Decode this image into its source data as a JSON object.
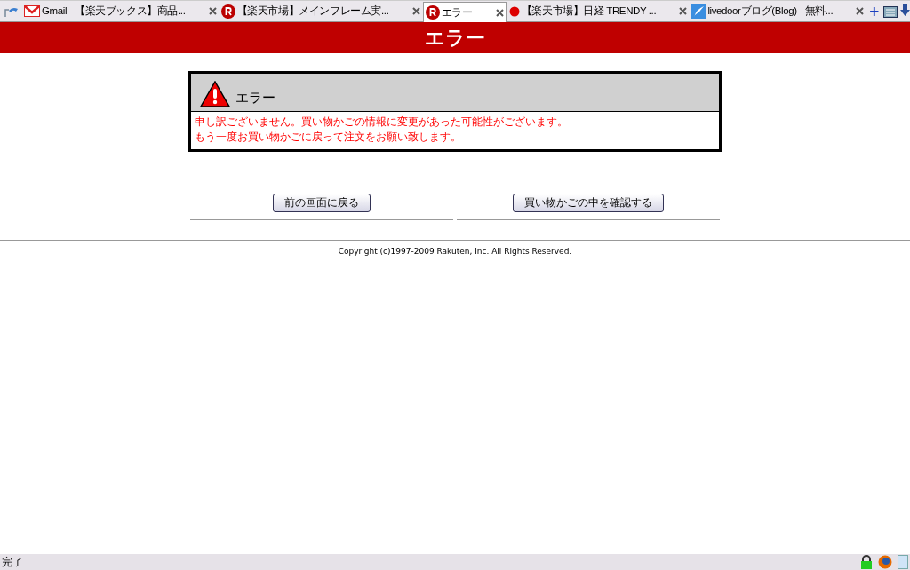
{
  "tabs": [
    {
      "label": "Gmail - 【楽天ブックス】商品...",
      "kind": "gmail",
      "selected": false
    },
    {
      "label": "【楽天市場】メインフレーム実...",
      "kind": "rakuten",
      "selected": false
    },
    {
      "label": "エラー",
      "kind": "rakuten",
      "selected": true
    },
    {
      "label": "【楽天市場】日経 TRENDY ...",
      "kind": "dot",
      "selected": false
    },
    {
      "label": "livedoorブログ(Blog) - 無料...",
      "kind": "feather",
      "selected": false
    }
  ],
  "tab_bar": {
    "new_tab": "+"
  },
  "banner": {
    "title": "エラー"
  },
  "error_box": {
    "title": "エラー",
    "lines": [
      "申し訳ございません。買い物かごの情報に変更があった可能性がございます。",
      "もう一度お買い物かごに戻って注文をお願い致します。"
    ]
  },
  "buttons": [
    "前の画面に戻る",
    "買い物かごの中を確認する"
  ],
  "footer": {
    "copyright": "Copyright (c)1997-2009 Rakuten, Inc. All Rights Reserved."
  },
  "status_bar": {
    "text": "完了"
  }
}
